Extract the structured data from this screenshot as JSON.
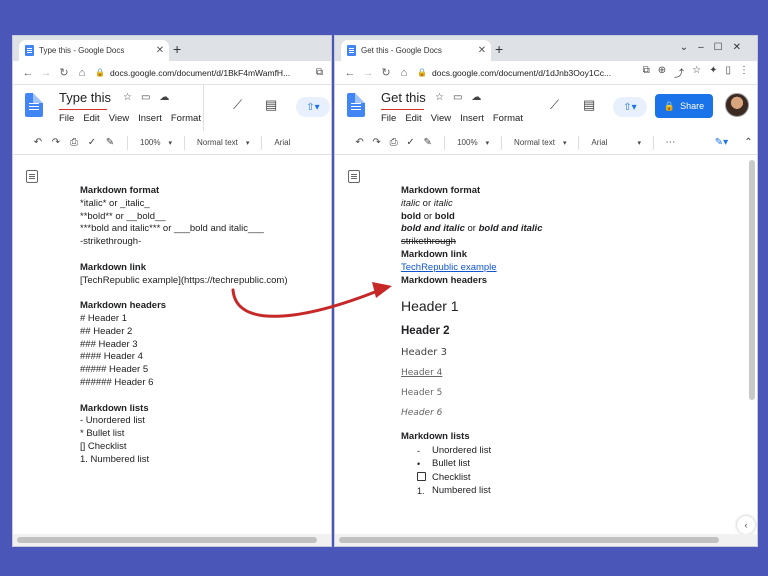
{
  "left_window": {
    "tab_title": "Type this - Google Docs",
    "url": "docs.google.com/document/d/1BkF4mWamfH...",
    "doc_title": "Type this",
    "menus": [
      "File",
      "Edit",
      "View",
      "Insert",
      "Format"
    ],
    "toolbar": {
      "zoom": "100%",
      "style": "Normal text",
      "font": "Arial"
    },
    "content": {
      "md_format_heading": "Markdown format",
      "md_format_lines": [
        "*italic* or _italic_",
        "**bold** or __bold__",
        "***bold and italic*** or ___bold and italic___",
        "-strikethrough-"
      ],
      "md_link_heading": "Markdown link",
      "md_link_line": "[TechRepublic example](https://techrepublic.com)",
      "md_headers_heading": "Markdown headers",
      "md_headers_lines": [
        "# Header 1",
        "## Header 2",
        "### Header 3",
        "#### Header 4",
        "##### Header 5",
        "###### Header 6"
      ],
      "md_lists_heading": "Markdown lists",
      "md_lists_lines": [
        "- Unordered list",
        "* Bullet list",
        "[] Checklist",
        "1. Numbered list"
      ]
    }
  },
  "right_window": {
    "tab_title": "Get this - Google Docs",
    "url": "docs.google.com/document/d/1dJnb3Ooy1Cc...",
    "doc_title": "Get this",
    "menus": [
      "File",
      "Edit",
      "View",
      "Insert",
      "Format"
    ],
    "share_label": "Share",
    "toolbar": {
      "zoom": "100%",
      "style": "Normal text",
      "font": "Arial"
    },
    "content": {
      "md_format_heading": "Markdown format",
      "italic_a": "italic",
      "or1": " or ",
      "italic_b": "italic",
      "bold_a": "bold",
      "or2": " or ",
      "bold_b": "bold",
      "bi_a": "bold and italic",
      "or3": " or ",
      "bi_b": "bold and italic",
      "strike": "strikethrough",
      "md_link_heading": "Markdown link",
      "link_text": "TechRepublic example",
      "md_headers_heading": "Markdown headers",
      "h1": "Header 1",
      "h2": "Header 2",
      "h3": "Header 3",
      "h4": "Header 4",
      "h5": "Header 5",
      "h6": "Header 6",
      "md_lists_heading": "Markdown lists",
      "list_unordered": "Unordered list",
      "list_bullet": "Bullet list",
      "list_check": "Checklist",
      "list_numbered": "Numbered list",
      "marker_dash": "-",
      "marker_bullet": "•",
      "marker_num": "1."
    }
  },
  "colors": {
    "background": "#4a56b8",
    "arrow": "#c62828",
    "link": "#1155cc",
    "share": "#1a73e8"
  }
}
